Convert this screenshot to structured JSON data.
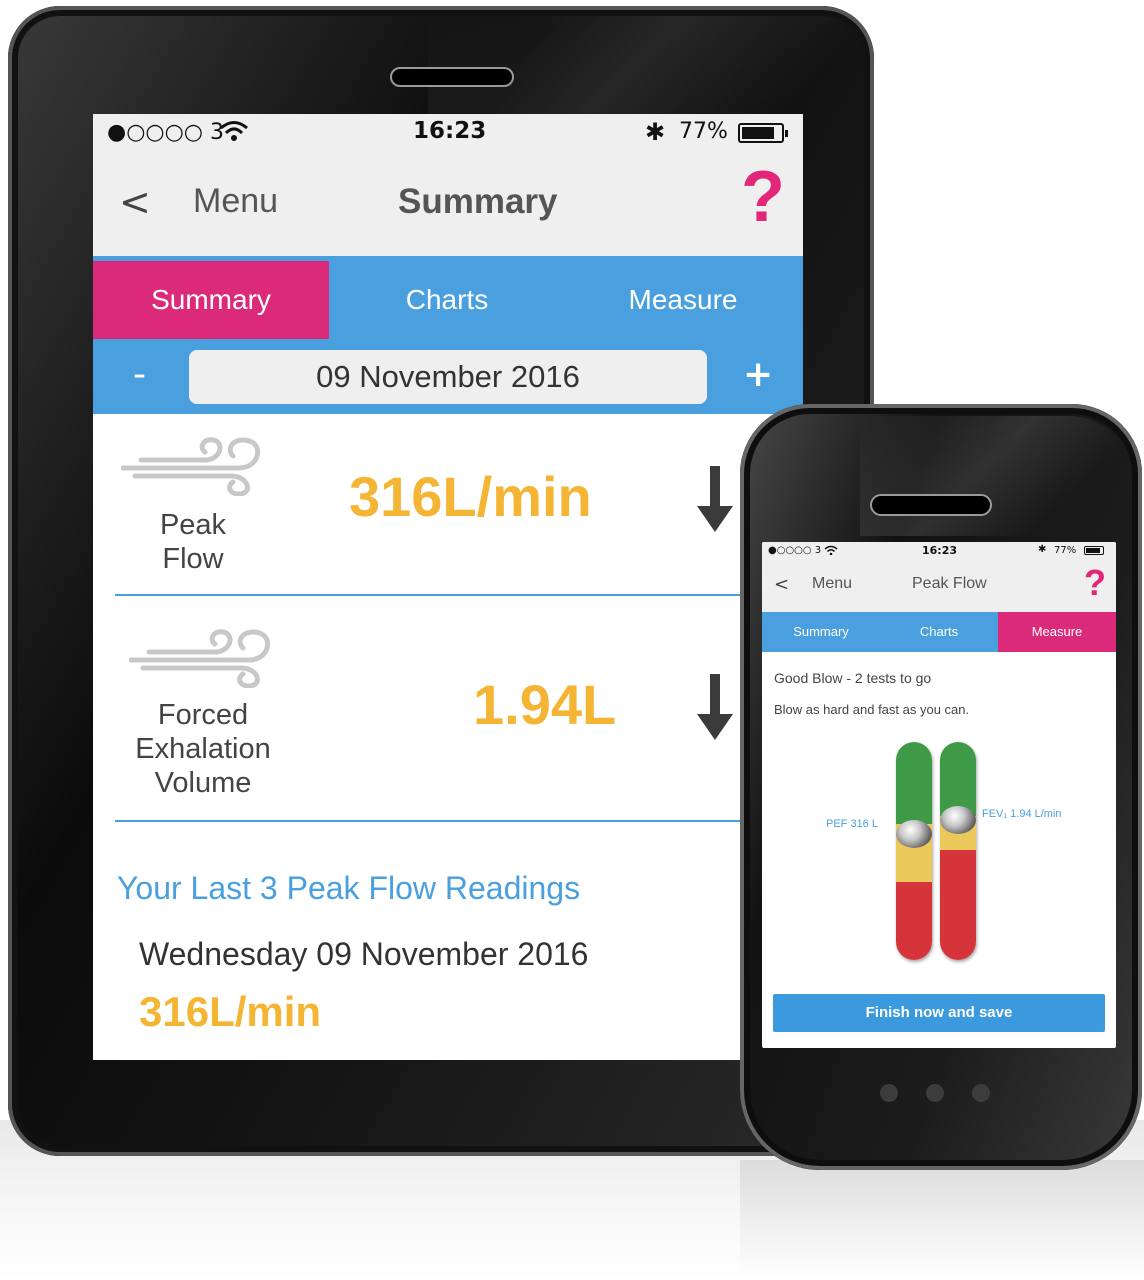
{
  "tablet": {
    "status_bar": {
      "carrier": "●○○○○ 3",
      "time": "16:23",
      "battery_percent": "77%",
      "bluetooth_icon": "bluetooth-icon",
      "wifi_icon": "wifi-icon"
    },
    "nav": {
      "back_label": "<",
      "menu_label": "Menu",
      "title": "Summary",
      "help_label": "?"
    },
    "tabs": [
      {
        "label": "Summary",
        "active": true
      },
      {
        "label": "Charts",
        "active": false
      },
      {
        "label": "Measure",
        "active": false
      }
    ],
    "date_selector": {
      "minus_label": "-",
      "date": "09 November 2016",
      "plus_label": "+"
    },
    "measurements": [
      {
        "label_lines": [
          "Peak",
          "Flow"
        ],
        "value": "316L/min",
        "trend": "down",
        "icon": "wind-icon"
      },
      {
        "label_lines": [
          "Forced",
          "Exhalation",
          "Volume"
        ],
        "value": "1.94L",
        "trend": "down",
        "icon": "wind-icon"
      }
    ],
    "readings": {
      "title": "Your Last 3 Peak Flow Readings",
      "items": [
        {
          "date": "Wednesday 09 November 2016",
          "value": "316L/min"
        }
      ]
    }
  },
  "phone": {
    "status_bar": {
      "carrier": "●○○○○ 3",
      "time": "16:23",
      "battery_percent": "77%"
    },
    "nav": {
      "back_label": "<",
      "menu_label": "Menu",
      "title": "Peak Flow",
      "help_label": "?"
    },
    "tabs": [
      {
        "label": "Summary",
        "active": false
      },
      {
        "label": "Charts",
        "active": false
      },
      {
        "label": "Measure",
        "active": true
      }
    ],
    "status_line": "Good Blow - 2 tests to go",
    "instruction": "Blow as hard and fast as you can.",
    "gauges": {
      "pef_label": "PEF 316 L",
      "fev_label": "FEV₁ 1.94 L/min"
    },
    "finish_button": "Finish now and save"
  },
  "colors": {
    "accent_pink": "#dc2a7a",
    "accent_blue": "#4aa0df",
    "value_yellow": "#f5b534",
    "gauge_green": "#3f9a48",
    "gauge_yellow": "#ebc85a",
    "gauge_red": "#d5353a"
  }
}
